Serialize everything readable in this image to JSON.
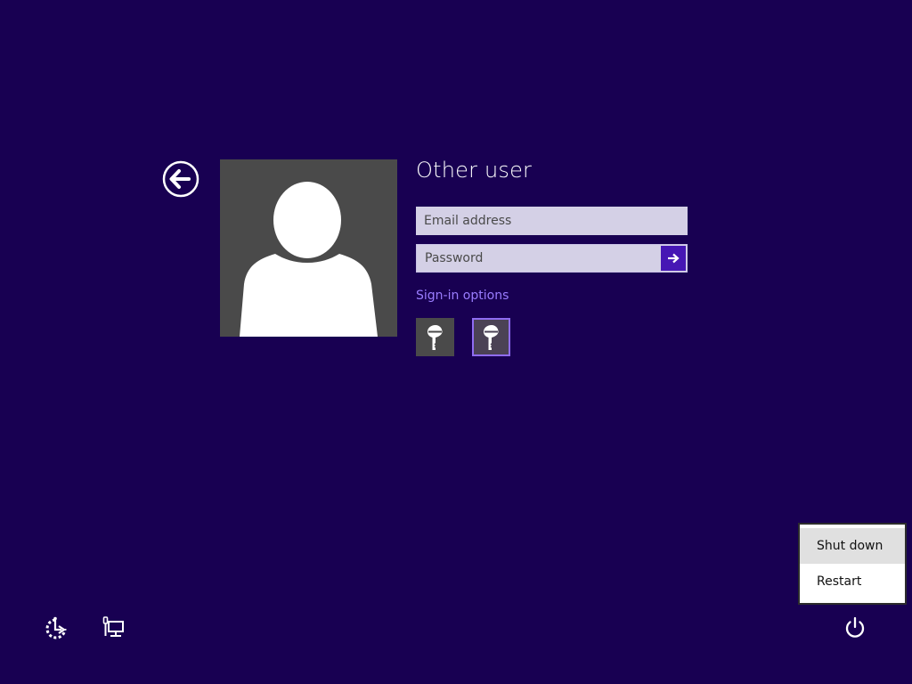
{
  "signin": {
    "title": "Other user",
    "email_placeholder": "Email address",
    "password_placeholder": "Password",
    "options_link": "Sign-in options"
  },
  "signin_options": [
    {
      "icon": "key-icon",
      "selected": false
    },
    {
      "icon": "key-icon",
      "selected": true
    }
  ],
  "power_menu": {
    "items": [
      {
        "label": "Shut down"
      },
      {
        "label": "Restart"
      }
    ]
  },
  "icons": {
    "back": "back-arrow-icon",
    "submit": "arrow-right-icon",
    "ease_of_access": "ease-of-access-icon",
    "network": "network-icon",
    "power": "power-icon"
  },
  "colors": {
    "background": "#180052",
    "accent": "#4617b4",
    "link": "#9a7dff",
    "input_bg": "#d4d0e6",
    "tile_bg": "#4a4a4a"
  }
}
